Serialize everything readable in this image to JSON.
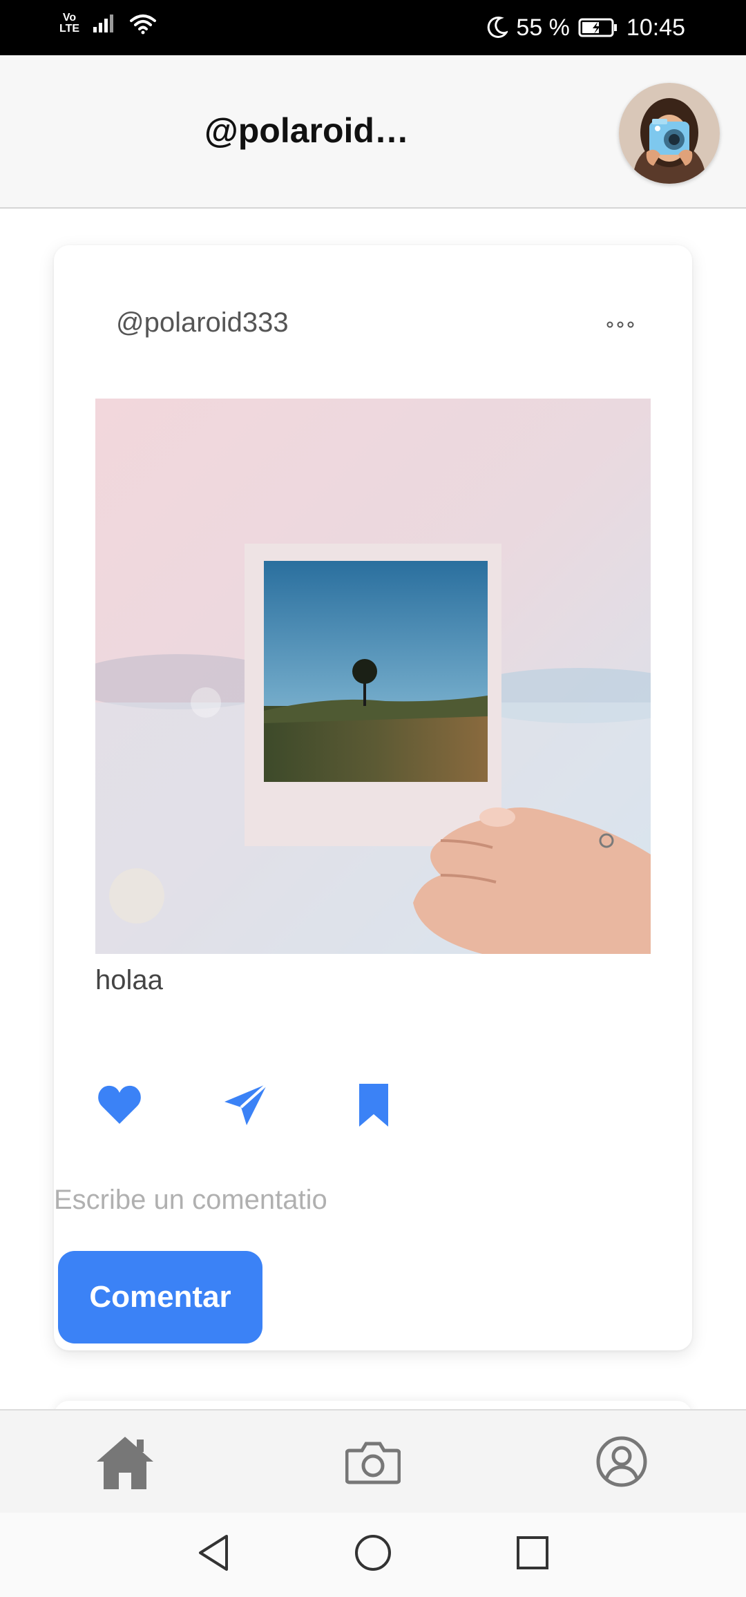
{
  "status_bar": {
    "network": "Vo LTE",
    "battery": "55 %",
    "time": "10:45",
    "icons": [
      "volte-icon",
      "signal-icon",
      "wifi-icon",
      "moon-icon",
      "battery-charging-icon"
    ]
  },
  "header": {
    "title": "@polaroid3…",
    "avatar_icon": "profile-avatar"
  },
  "post": {
    "username": "@polaroid333",
    "more_icon": "more-horizontal-icon",
    "image_icon": "polaroid-photo",
    "caption": "holaa",
    "actions": [
      "heart-icon",
      "send-icon",
      "bookmark-icon"
    ],
    "comment": {
      "placeholder": "Escribe un comentatio",
      "value": "",
      "button_label": "Comentar"
    }
  },
  "tab_bar": {
    "items": [
      "home-icon",
      "camera-icon",
      "user-icon"
    ]
  },
  "system_nav": {
    "items": [
      "back-icon",
      "home-circle-icon",
      "recents-icon"
    ]
  },
  "colors": {
    "accent": "#3b82f6",
    "tab_icon": "#777777",
    "status_bar": "#000000"
  }
}
